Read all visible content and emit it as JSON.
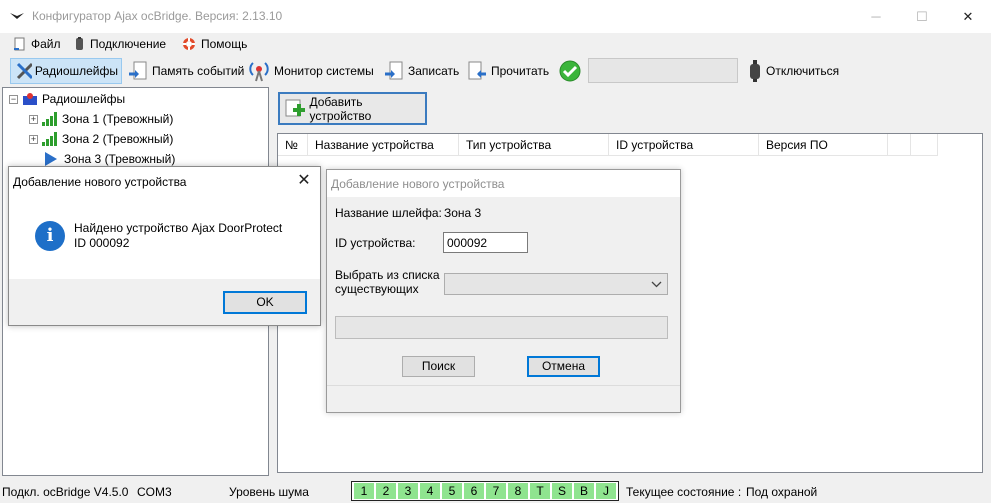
{
  "window": {
    "title": "Конфигуратор Ajax ocBridge. Версия: 2.13.10",
    "controls": [
      "─",
      "☐",
      "✕"
    ]
  },
  "menu": {
    "file": "Файл",
    "connection": "Подключение",
    "help": "Помощь"
  },
  "toolbar": {
    "radio_loops": "Радиошлейфы",
    "event_memory": "Память событий",
    "system_monitor": "Монитор системы",
    "write": "Записать",
    "read": "Прочитать",
    "disconnect": "Отключиться"
  },
  "tree": {
    "root": "Радиошлейфы",
    "zones": [
      {
        "label": "Зона 1 (Тревожный)"
      },
      {
        "label": "Зона 2 (Тревожный)"
      },
      {
        "label": "Зона 3 (Тревожный)"
      }
    ]
  },
  "devices": {
    "add_button": "Добавить устройство",
    "columns": [
      "№",
      "Название устройства",
      "Тип устройства",
      "ID устройства",
      "Версия ПО",
      "",
      ""
    ]
  },
  "found_dialog": {
    "title": "Добавление нового устройства",
    "message_line1": "Найдено устройство Ajax DoorProtect",
    "message_line2": "ID 000092",
    "ok": "OK",
    "close": "✕"
  },
  "add_dialog": {
    "title": "Добавление нового устройства",
    "loop_name_label": "Название шлейфа:",
    "loop_name_value": "Зона 3",
    "device_id_label": "ID устройства:",
    "device_id_value": "000092",
    "select_label_line1": "Выбрать из списка",
    "select_label_line2": "существующих",
    "search": "Поиск",
    "cancel": "Отмена"
  },
  "status": {
    "connected": "Подкл. ocBridge V4.5.0",
    "port": "COM3",
    "noise_label": "Уровень шума",
    "noise_cells": [
      "1",
      "2",
      "3",
      "4",
      "5",
      "6",
      "7",
      "8",
      "T",
      "S",
      "B",
      "J"
    ],
    "state_label": "Текущее состояние :",
    "state_value": "Под охраной"
  },
  "colors": {
    "accent": "#0078d7",
    "noise_cell": "#8fe48f",
    "info_icon": "#1e6fc8",
    "check_ok": "#3bb53b"
  }
}
